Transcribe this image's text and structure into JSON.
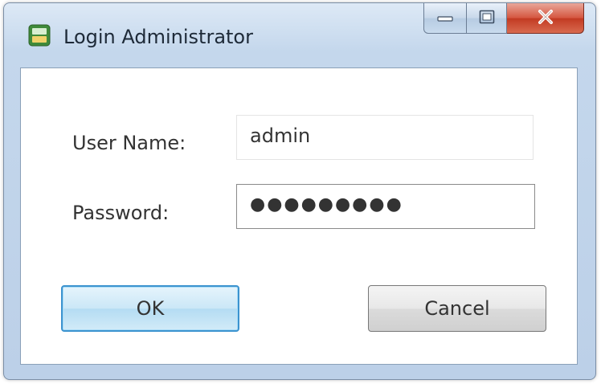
{
  "window": {
    "title": "Login Administrator",
    "icon": "app-window-icon",
    "caption_buttons": [
      "minimize-icon",
      "maximize-icon",
      "close-icon"
    ]
  },
  "form": {
    "username_label": "User Name:",
    "username_value": "admin",
    "password_label": "Password:",
    "password_mask": "●●●●●●●●●"
  },
  "buttons": {
    "ok_label": "OK",
    "cancel_label": "Cancel"
  },
  "colors": {
    "ok_border": "#3c93cf",
    "close_button": "#c23a22",
    "titlebar": "#c4d7ec"
  }
}
